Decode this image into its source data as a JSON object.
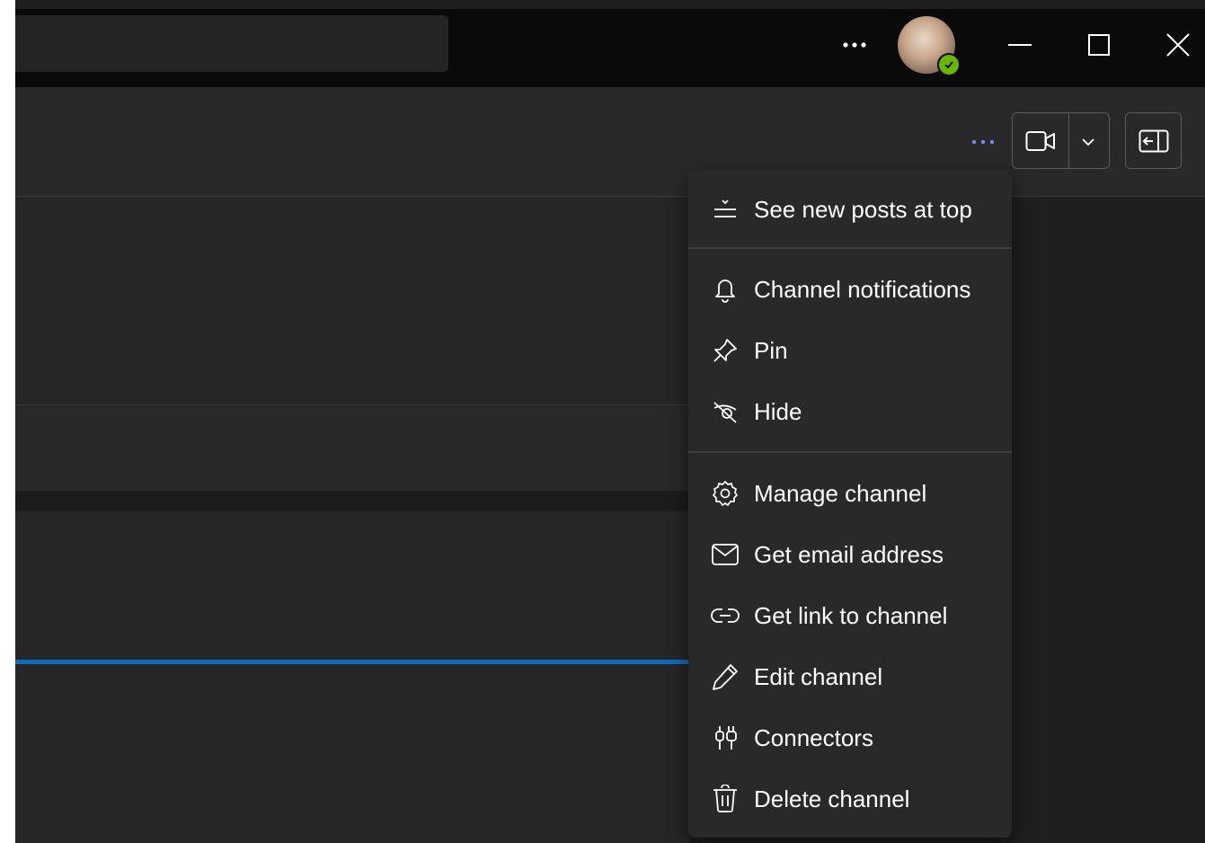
{
  "titlebar": {
    "more_icon": "more-horizontal-icon",
    "avatar_status": "available",
    "window_controls": [
      "minimize-icon",
      "maximize-icon",
      "close-icon"
    ]
  },
  "header": {
    "more_icon": "more-horizontal-icon",
    "call_icon": "video-camera-icon",
    "dropdown_icon": "chevron-down-icon",
    "panel_icon": "side-panel-icon"
  },
  "colors": {
    "accent_blue": "#0f6cbd",
    "more_dots": "#7f85f5",
    "presence_green": "#6bb700",
    "menu_bg": "#292929",
    "titlebar_bg": "#0a0a0a"
  },
  "menu": {
    "group1": [
      {
        "label": "See new posts at top",
        "icon": "sort-new-top-icon"
      }
    ],
    "group2": [
      {
        "label": "Channel notifications",
        "icon": "bell-icon"
      },
      {
        "label": "Pin",
        "icon": "pin-icon"
      },
      {
        "label": "Hide",
        "icon": "eye-off-icon"
      }
    ],
    "group3": [
      {
        "label": "Manage channel",
        "icon": "gear-icon"
      },
      {
        "label": "Get email address",
        "icon": "mail-icon"
      },
      {
        "label": "Get link to channel",
        "icon": "link-icon"
      },
      {
        "label": "Edit channel",
        "icon": "pencil-icon"
      },
      {
        "label": "Connectors",
        "icon": "connectors-icon"
      },
      {
        "label": "Delete channel",
        "icon": "trash-icon"
      }
    ]
  }
}
